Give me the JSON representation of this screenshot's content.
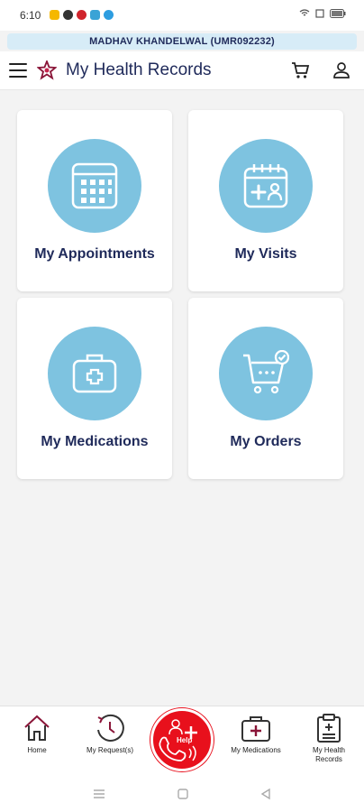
{
  "status_bar": {
    "time": "6:10"
  },
  "patient_banner": {
    "text": "MADHAV KHANDELWAL (UMR092232)"
  },
  "header": {
    "title": "My Health Records"
  },
  "cards": {
    "appointments": {
      "label": "My Appointments"
    },
    "visits": {
      "label": "My Visits"
    },
    "medications": {
      "label": "My Medications"
    },
    "orders": {
      "label": "My Orders"
    }
  },
  "bottom_nav": {
    "home": "Home",
    "requests": "My Request(s)",
    "help": "Help",
    "medications": "My Medications",
    "records_line1": "My Health",
    "records_line2": "Records"
  },
  "colors": {
    "accent": "#7ec3e0",
    "title": "#1f2a5a",
    "help": "#e8101c",
    "banner": "#d7ecf7"
  },
  "icons": [
    "menu-icon",
    "logo-icon",
    "cart-icon",
    "user-icon",
    "calendar-icon",
    "visit-calendar-icon",
    "medical-kit-icon",
    "cart-check-icon",
    "home-icon",
    "request-clock-icon",
    "help-phone-icon",
    "medications-icon",
    "health-record-icon"
  ]
}
